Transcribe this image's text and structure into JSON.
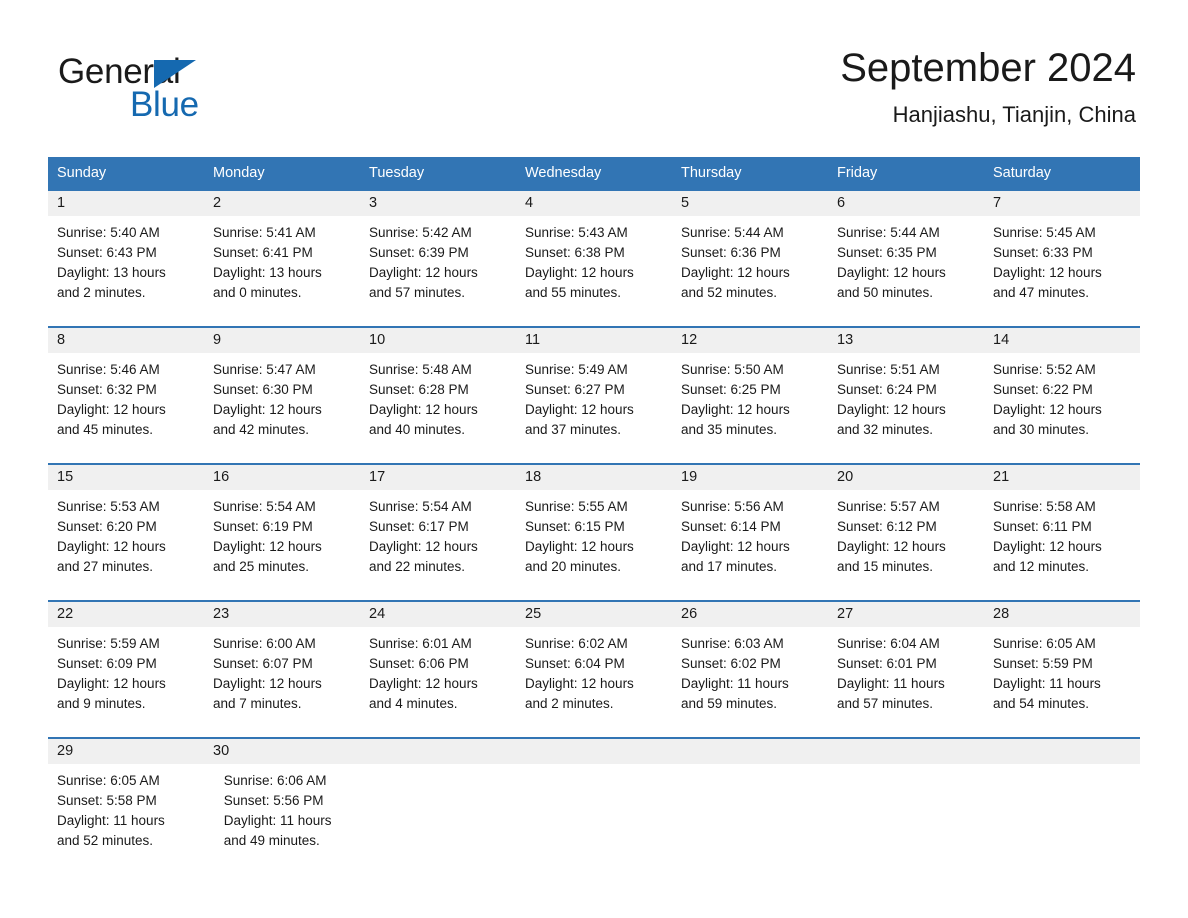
{
  "brand": {
    "word1": "General",
    "word2": "Blue",
    "triangle_color": "#1569b0",
    "text_color": "#1a1a1a"
  },
  "header": {
    "month_title": "September 2024",
    "location": "Hanjiashu, Tianjin, China"
  },
  "theme": {
    "header_blue": "#3275b4",
    "date_band_gray": "#f0f0f0",
    "separator_blue": "#3275b4",
    "page_background": "#ffffff"
  },
  "weekdays": [
    "Sunday",
    "Monday",
    "Tuesday",
    "Wednesday",
    "Thursday",
    "Friday",
    "Saturday"
  ],
  "calendar": {
    "weeks": [
      {
        "days": [
          {
            "date": "1",
            "sunrise": "Sunrise: 5:40 AM",
            "sunset": "Sunset: 6:43 PM",
            "daylight_line1": "Daylight: 13 hours",
            "daylight_line2": "and 2 minutes."
          },
          {
            "date": "2",
            "sunrise": "Sunrise: 5:41 AM",
            "sunset": "Sunset: 6:41 PM",
            "daylight_line1": "Daylight: 13 hours",
            "daylight_line2": "and 0 minutes."
          },
          {
            "date": "3",
            "sunrise": "Sunrise: 5:42 AM",
            "sunset": "Sunset: 6:39 PM",
            "daylight_line1": "Daylight: 12 hours",
            "daylight_line2": "and 57 minutes."
          },
          {
            "date": "4",
            "sunrise": "Sunrise: 5:43 AM",
            "sunset": "Sunset: 6:38 PM",
            "daylight_line1": "Daylight: 12 hours",
            "daylight_line2": "and 55 minutes."
          },
          {
            "date": "5",
            "sunrise": "Sunrise: 5:44 AM",
            "sunset": "Sunset: 6:36 PM",
            "daylight_line1": "Daylight: 12 hours",
            "daylight_line2": "and 52 minutes."
          },
          {
            "date": "6",
            "sunrise": "Sunrise: 5:44 AM",
            "sunset": "Sunset: 6:35 PM",
            "daylight_line1": "Daylight: 12 hours",
            "daylight_line2": "and 50 minutes."
          },
          {
            "date": "7",
            "sunrise": "Sunrise: 5:45 AM",
            "sunset": "Sunset: 6:33 PM",
            "daylight_line1": "Daylight: 12 hours",
            "daylight_line2": "and 47 minutes."
          }
        ]
      },
      {
        "days": [
          {
            "date": "8",
            "sunrise": "Sunrise: 5:46 AM",
            "sunset": "Sunset: 6:32 PM",
            "daylight_line1": "Daylight: 12 hours",
            "daylight_line2": "and 45 minutes."
          },
          {
            "date": "9",
            "sunrise": "Sunrise: 5:47 AM",
            "sunset": "Sunset: 6:30 PM",
            "daylight_line1": "Daylight: 12 hours",
            "daylight_line2": "and 42 minutes."
          },
          {
            "date": "10",
            "sunrise": "Sunrise: 5:48 AM",
            "sunset": "Sunset: 6:28 PM",
            "daylight_line1": "Daylight: 12 hours",
            "daylight_line2": "and 40 minutes."
          },
          {
            "date": "11",
            "sunrise": "Sunrise: 5:49 AM",
            "sunset": "Sunset: 6:27 PM",
            "daylight_line1": "Daylight: 12 hours",
            "daylight_line2": "and 37 minutes."
          },
          {
            "date": "12",
            "sunrise": "Sunrise: 5:50 AM",
            "sunset": "Sunset: 6:25 PM",
            "daylight_line1": "Daylight: 12 hours",
            "daylight_line2": "and 35 minutes."
          },
          {
            "date": "13",
            "sunrise": "Sunrise: 5:51 AM",
            "sunset": "Sunset: 6:24 PM",
            "daylight_line1": "Daylight: 12 hours",
            "daylight_line2": "and 32 minutes."
          },
          {
            "date": "14",
            "sunrise": "Sunrise: 5:52 AM",
            "sunset": "Sunset: 6:22 PM",
            "daylight_line1": "Daylight: 12 hours",
            "daylight_line2": "and 30 minutes."
          }
        ]
      },
      {
        "days": [
          {
            "date": "15",
            "sunrise": "Sunrise: 5:53 AM",
            "sunset": "Sunset: 6:20 PM",
            "daylight_line1": "Daylight: 12 hours",
            "daylight_line2": "and 27 minutes."
          },
          {
            "date": "16",
            "sunrise": "Sunrise: 5:54 AM",
            "sunset": "Sunset: 6:19 PM",
            "daylight_line1": "Daylight: 12 hours",
            "daylight_line2": "and 25 minutes."
          },
          {
            "date": "17",
            "sunrise": "Sunrise: 5:54 AM",
            "sunset": "Sunset: 6:17 PM",
            "daylight_line1": "Daylight: 12 hours",
            "daylight_line2": "and 22 minutes."
          },
          {
            "date": "18",
            "sunrise": "Sunrise: 5:55 AM",
            "sunset": "Sunset: 6:15 PM",
            "daylight_line1": "Daylight: 12 hours",
            "daylight_line2": "and 20 minutes."
          },
          {
            "date": "19",
            "sunrise": "Sunrise: 5:56 AM",
            "sunset": "Sunset: 6:14 PM",
            "daylight_line1": "Daylight: 12 hours",
            "daylight_line2": "and 17 minutes."
          },
          {
            "date": "20",
            "sunrise": "Sunrise: 5:57 AM",
            "sunset": "Sunset: 6:12 PM",
            "daylight_line1": "Daylight: 12 hours",
            "daylight_line2": "and 15 minutes."
          },
          {
            "date": "21",
            "sunrise": "Sunrise: 5:58 AM",
            "sunset": "Sunset: 6:11 PM",
            "daylight_line1": "Daylight: 12 hours",
            "daylight_line2": "and 12 minutes."
          }
        ]
      },
      {
        "days": [
          {
            "date": "22",
            "sunrise": "Sunrise: 5:59 AM",
            "sunset": "Sunset: 6:09 PM",
            "daylight_line1": "Daylight: 12 hours",
            "daylight_line2": "and 9 minutes."
          },
          {
            "date": "23",
            "sunrise": "Sunrise: 6:00 AM",
            "sunset": "Sunset: 6:07 PM",
            "daylight_line1": "Daylight: 12 hours",
            "daylight_line2": "and 7 minutes."
          },
          {
            "date": "24",
            "sunrise": "Sunrise: 6:01 AM",
            "sunset": "Sunset: 6:06 PM",
            "daylight_line1": "Daylight: 12 hours",
            "daylight_line2": "and 4 minutes."
          },
          {
            "date": "25",
            "sunrise": "Sunrise: 6:02 AM",
            "sunset": "Sunset: 6:04 PM",
            "daylight_line1": "Daylight: 12 hours",
            "daylight_line2": "and 2 minutes."
          },
          {
            "date": "26",
            "sunrise": "Sunrise: 6:03 AM",
            "sunset": "Sunset: 6:02 PM",
            "daylight_line1": "Daylight: 11 hours",
            "daylight_line2": "and 59 minutes."
          },
          {
            "date": "27",
            "sunrise": "Sunrise: 6:04 AM",
            "sunset": "Sunset: 6:01 PM",
            "daylight_line1": "Daylight: 11 hours",
            "daylight_line2": "and 57 minutes."
          },
          {
            "date": "28",
            "sunrise": "Sunrise: 6:05 AM",
            "sunset": "Sunset: 5:59 PM",
            "daylight_line1": "Daylight: 11 hours",
            "daylight_line2": "and 54 minutes."
          }
        ]
      },
      {
        "days": [
          {
            "date": "29",
            "sunrise": "Sunrise: 6:05 AM",
            "sunset": "Sunset: 5:58 PM",
            "daylight_line1": "Daylight: 11 hours",
            "daylight_line2": "and 52 minutes."
          },
          {
            "date": "30",
            "sunrise": "Sunrise: 6:06 AM",
            "sunset": "Sunset: 5:56 PM",
            "daylight_line1": "Daylight: 11 hours",
            "daylight_line2": "and 49 minutes."
          },
          {
            "date": "",
            "sunrise": "",
            "sunset": "",
            "daylight_line1": "",
            "daylight_line2": ""
          },
          {
            "date": "",
            "sunrise": "",
            "sunset": "",
            "daylight_line1": "",
            "daylight_line2": ""
          },
          {
            "date": "",
            "sunrise": "",
            "sunset": "",
            "daylight_line1": "",
            "daylight_line2": ""
          },
          {
            "date": "",
            "sunrise": "",
            "sunset": "",
            "daylight_line1": "",
            "daylight_line2": ""
          },
          {
            "date": "",
            "sunrise": "",
            "sunset": "",
            "daylight_line1": "",
            "daylight_line2": ""
          }
        ]
      }
    ]
  }
}
